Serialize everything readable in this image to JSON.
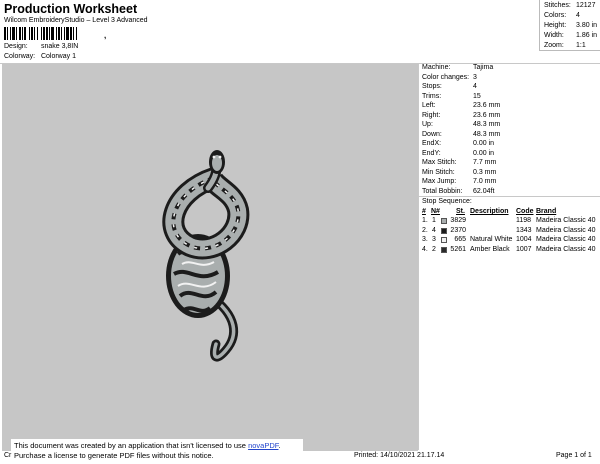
{
  "header": {
    "title": "Production Worksheet",
    "subtitle": "Wilcom EmbroideryStudio – Level 3 Advanced",
    "barcode_mark": ",",
    "design_label": "Design:",
    "design_value": "snake 3,8IN",
    "colorway_label": "Colorway:",
    "colorway_value": "Colorway 1"
  },
  "summary": {
    "stitches_label": "Stitches:",
    "stitches_value": "12127",
    "colors_label": "Colors:",
    "colors_value": "4",
    "height_label": "Height:",
    "height_value": "3.80 in",
    "width_label": "Width:",
    "width_value": "1.86 in",
    "zoom_label": "Zoom:",
    "zoom_value": "1:1"
  },
  "machine": [
    {
      "label": "Machine:",
      "value": "Tajima"
    },
    {
      "label": "Color changes:",
      "value": "3"
    },
    {
      "label": "Stops:",
      "value": "4"
    },
    {
      "label": "Trims:",
      "value": "15"
    },
    {
      "label": "Left:",
      "value": "23.6 mm"
    },
    {
      "label": "Right:",
      "value": "23.6 mm"
    },
    {
      "label": "Up:",
      "value": "48.3 mm"
    },
    {
      "label": "Down:",
      "value": "48.3 mm"
    },
    {
      "label": "EndX:",
      "value": "0.00 in"
    },
    {
      "label": "EndY:",
      "value": "0.00 in"
    },
    {
      "label": "Max Stitch:",
      "value": "7.7 mm"
    },
    {
      "label": "Min Stitch:",
      "value": "0.3 mm"
    },
    {
      "label": "Max Jump:",
      "value": "7.0 mm"
    },
    {
      "label": "Total Bobbin:",
      "value": "62.04ft"
    }
  ],
  "stop_sequence": {
    "title": "Stop Sequence:",
    "headers": {
      "num": "#",
      "n": "N#",
      "st": "St.",
      "description": "Description",
      "code": "Code",
      "brand": "Brand"
    },
    "rows": [
      {
        "num": "1.",
        "n": "1",
        "color": "#a9aeae",
        "st": "3829",
        "description": "",
        "code": "1198",
        "brand": "Madeira Classic 40"
      },
      {
        "num": "2.",
        "n": "4",
        "color": "#1c1c1c",
        "st": "2370",
        "description": "",
        "code": "1343",
        "brand": "Madeira Classic 40"
      },
      {
        "num": "3.",
        "n": "3",
        "color": "#f2f2f2",
        "st": "665",
        "description": "Natural White",
        "code": "1004",
        "brand": "Madeira Classic 40"
      },
      {
        "num": "4.",
        "n": "2",
        "color": "#2a2a2a",
        "st": "5261",
        "description": "Amber Black",
        "code": "1007",
        "brand": "Madeira Classic 40"
      }
    ]
  },
  "footer": {
    "note_line1": "This document was created by an application that isn't licensed to use ",
    "note_link": "novaPDF",
    "note_line1_end": ".",
    "note_line2": "Purchase a license to generate PDF files without this notice.",
    "cr": "Cr",
    "printed": "Printed: 14/10/2021 21.17.14",
    "page": "Page 1 of 1"
  },
  "colors": {
    "canvas_bg": "#c6c6c6",
    "snake_dark": "#1c1c1c",
    "snake_light": "#a9aeae",
    "snake_white": "#f2f2f2",
    "link": "#2245cc"
  }
}
